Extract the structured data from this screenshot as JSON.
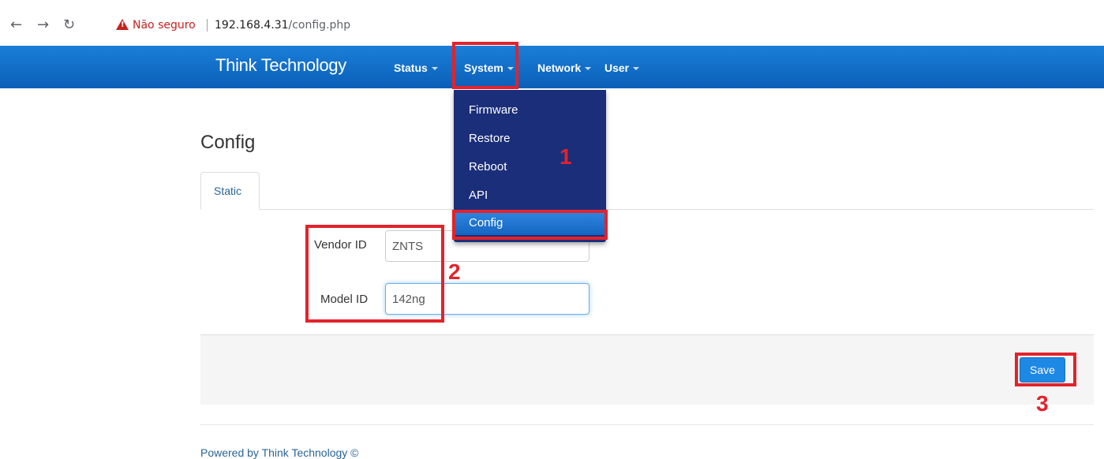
{
  "browser": {
    "insecure_label": "Não seguro",
    "url_host": "192.168.4.31",
    "url_path": "/config.php"
  },
  "navbar": {
    "brand": "Think Technology",
    "items": [
      {
        "label": "Status"
      },
      {
        "label": "System"
      },
      {
        "label": "Network"
      },
      {
        "label": "User"
      }
    ]
  },
  "dropdown": {
    "items": [
      {
        "label": "Firmware"
      },
      {
        "label": "Restore"
      },
      {
        "label": "Reboot"
      },
      {
        "label": "API"
      },
      {
        "label": "Config",
        "active": true
      }
    ]
  },
  "page": {
    "title": "Config",
    "tabs": [
      {
        "label": "Static",
        "active": true
      }
    ],
    "fields": [
      {
        "label": "Vendor ID",
        "value": "ZNTS"
      },
      {
        "label": "Model ID",
        "value": "142ng"
      }
    ],
    "save_label": "Save"
  },
  "footer": {
    "text": "Powered by Think Technology ©"
  },
  "annotations": {
    "numbers": [
      "1",
      "2",
      "3"
    ],
    "color": "#e3222b"
  },
  "colors": {
    "navbar": "#0b5fb8",
    "dropdown": "#1b2e7a",
    "save_button": "#1e88e5"
  }
}
